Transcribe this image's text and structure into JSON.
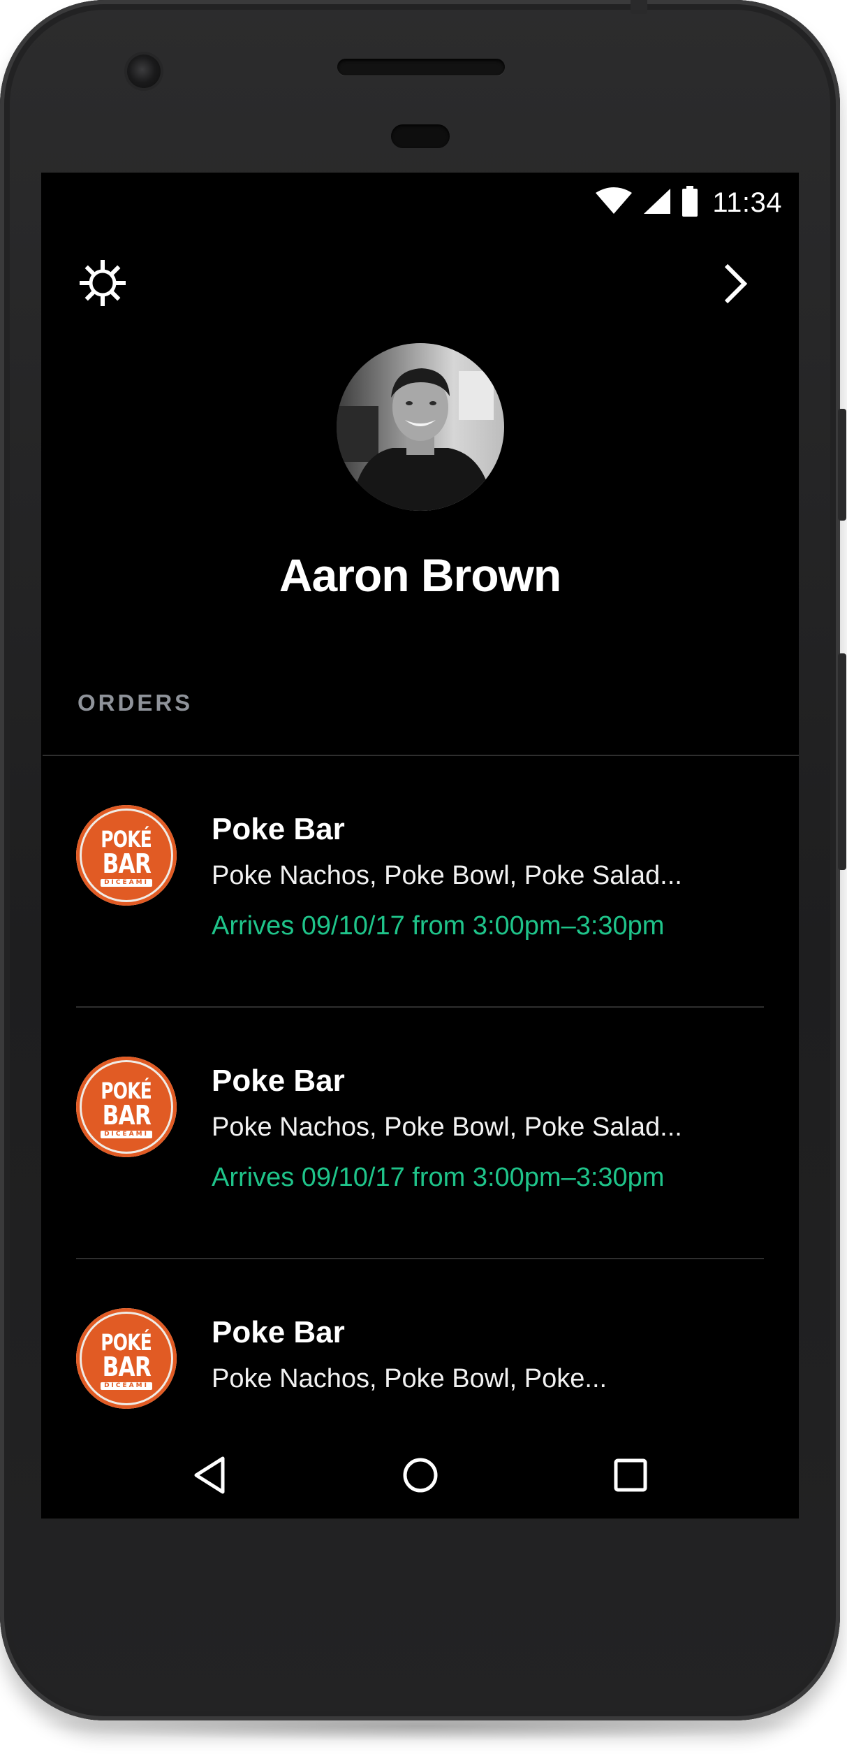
{
  "status_bar": {
    "time": "11:34",
    "icons": [
      "wifi-icon",
      "cellular-signal-icon",
      "battery-icon"
    ]
  },
  "header": {
    "left_icon": "gear-icon",
    "right_icon": "chevron-right-icon"
  },
  "profile": {
    "name": "Aaron Brown",
    "avatar": "avatar-photo"
  },
  "orders": {
    "section_label": "ORDERS",
    "items": [
      {
        "restaurant": "Poke Bar",
        "items": "Poke Nachos, Poke Bowl, Poke Salad...",
        "eta": "Arrives 09/10/17 from 3:00pm–3:30pm",
        "logo": {
          "line1": "POKÉ",
          "line2": "BAR",
          "line3": "DICEAMI"
        }
      },
      {
        "restaurant": "Poke Bar",
        "items": "Poke Nachos, Poke Bowl, Poke Salad...",
        "eta": "Arrives 09/10/17 from 3:00pm–3:30pm",
        "logo": {
          "line1": "POKÉ",
          "line2": "BAR",
          "line3": "DICEAMI"
        }
      },
      {
        "restaurant": "Poke Bar",
        "items": "Poke Nachos, Poke Bowl, Poke...",
        "eta": "",
        "logo": {
          "line1": "POKÉ",
          "line2": "BAR",
          "line3": "DICEAMI"
        }
      }
    ]
  },
  "nav_bar": {
    "icons": [
      "back-icon",
      "home-icon",
      "recent-apps-icon"
    ]
  },
  "colors": {
    "screen_background": "#000000",
    "accent_green": "#1fc48a",
    "logo_orange": "#e15b24",
    "section_label": "#8f939a",
    "divider": "#2f2f2f",
    "phone_body": "#222223"
  }
}
